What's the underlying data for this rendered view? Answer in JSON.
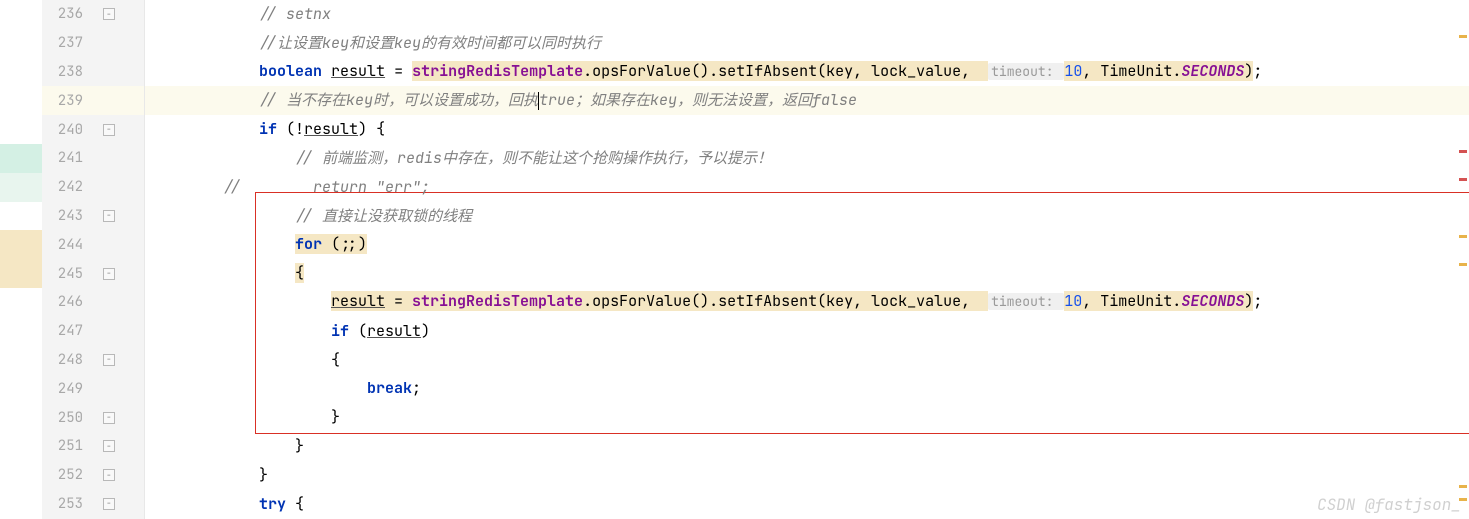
{
  "watermark": "CSDN @fastjson_",
  "lines": [
    {
      "num": "236",
      "fold": true,
      "segments": [
        {
          "indent": "            ",
          "cls": ""
        },
        {
          "text": "// setnx",
          "cls": "comment"
        }
      ]
    },
    {
      "num": "237",
      "fold": false,
      "segments": [
        {
          "indent": "            ",
          "cls": ""
        },
        {
          "text": "//让设置key和设置key的有效时间都可以同时执行",
          "cls": "comment"
        }
      ]
    },
    {
      "num": "238",
      "fold": false,
      "highlight": true,
      "segments": [
        {
          "indent": "            ",
          "cls": ""
        },
        {
          "text": "boolean",
          "cls": "keyword"
        },
        {
          "text": " ",
          "cls": ""
        },
        {
          "text": "result",
          "cls": "underline"
        },
        {
          "text": " = ",
          "cls": ""
        },
        {
          "text": "stringRedisTemplate",
          "cls": "field hl-yellow"
        },
        {
          "text": ".opsForValue().setIfAbsent(key, lock_value,  ",
          "cls": "hl-yellow"
        },
        {
          "text": "timeout: ",
          "cls": "param-hint"
        },
        {
          "text": "10",
          "cls": "number hl-yellow"
        },
        {
          "text": ", TimeUnit.",
          "cls": "hl-yellow"
        },
        {
          "text": "SECONDS",
          "cls": "field-italic hl-yellow"
        },
        {
          "text": ")",
          "cls": "hl-yellow"
        },
        {
          "text": ";",
          "cls": ""
        }
      ]
    },
    {
      "num": "239",
      "fold": false,
      "currentLine": true,
      "segments": [
        {
          "indent": "            ",
          "cls": ""
        },
        {
          "text": "// 当不存在key时，可以设置成功，回执",
          "cls": "comment"
        },
        {
          "caret": true
        },
        {
          "text": "true；如果存在key，则无法设置，返回false",
          "cls": "comment"
        }
      ]
    },
    {
      "num": "240",
      "fold": true,
      "segments": [
        {
          "indent": "            ",
          "cls": ""
        },
        {
          "text": "if",
          "cls": "keyword"
        },
        {
          "text": " (!",
          "cls": ""
        },
        {
          "text": "result",
          "cls": "underline"
        },
        {
          "text": ") {",
          "cls": ""
        }
      ]
    },
    {
      "num": "241",
      "fold": false,
      "leftBar": "#d4f0e4",
      "segments": [
        {
          "indent": "                ",
          "cls": ""
        },
        {
          "text": "// 前端监测，redis中存在，则不能让这个抢购操作执行，予以提示！",
          "cls": "comment"
        }
      ]
    },
    {
      "num": "242",
      "fold": false,
      "leftBar": "#e8f5ee",
      "segments": [
        {
          "indent": "        ",
          "cls": ""
        },
        {
          "text": "//        return \"err\";",
          "cls": "comment"
        }
      ]
    },
    {
      "num": "243",
      "fold": true,
      "segments": [
        {
          "indent": "                ",
          "cls": ""
        },
        {
          "text": "// 直接让没获取锁的线程",
          "cls": "comment"
        }
      ]
    },
    {
      "num": "244",
      "fold": false,
      "leftBar": "#f5e7c4",
      "segments": [
        {
          "indent": "                ",
          "cls": ""
        },
        {
          "text": "for",
          "cls": "keyword hl-yellow"
        },
        {
          "text": " (;;)",
          "cls": "hl-yellow"
        }
      ]
    },
    {
      "num": "245",
      "fold": true,
      "leftBar": "#f5e7c4",
      "segments": [
        {
          "indent": "                ",
          "cls": ""
        },
        {
          "text": "{",
          "cls": "hl-yellow"
        }
      ]
    },
    {
      "num": "246",
      "fold": false,
      "segments": [
        {
          "indent": "                    ",
          "cls": ""
        },
        {
          "text": "result",
          "cls": "underline hl-yellow"
        },
        {
          "text": " = ",
          "cls": "hl-yellow"
        },
        {
          "text": "stringRedisTemplate",
          "cls": "field hl-yellow"
        },
        {
          "text": ".opsForValue().setIfAbsent(key, lock_value,  ",
          "cls": "hl-yellow"
        },
        {
          "text": "timeout: ",
          "cls": "param-hint"
        },
        {
          "text": "10",
          "cls": "number hl-yellow"
        },
        {
          "text": ", TimeUnit.",
          "cls": "hl-yellow"
        },
        {
          "text": "SECONDS",
          "cls": "field-italic hl-yellow"
        },
        {
          "text": ")",
          "cls": "hl-yellow"
        },
        {
          "text": ";",
          "cls": ""
        }
      ]
    },
    {
      "num": "247",
      "fold": false,
      "segments": [
        {
          "indent": "                    ",
          "cls": ""
        },
        {
          "text": "if",
          "cls": "keyword"
        },
        {
          "text": " (",
          "cls": ""
        },
        {
          "text": "result",
          "cls": "underline"
        },
        {
          "text": ")",
          "cls": ""
        }
      ]
    },
    {
      "num": "248",
      "fold": true,
      "segments": [
        {
          "indent": "                    ",
          "cls": ""
        },
        {
          "text": "{",
          "cls": ""
        }
      ]
    },
    {
      "num": "249",
      "fold": false,
      "segments": [
        {
          "indent": "                        ",
          "cls": ""
        },
        {
          "text": "break",
          "cls": "keyword"
        },
        {
          "text": ";",
          "cls": ""
        }
      ]
    },
    {
      "num": "250",
      "fold": true,
      "segments": [
        {
          "indent": "                    ",
          "cls": ""
        },
        {
          "text": "}",
          "cls": ""
        }
      ]
    },
    {
      "num": "251",
      "fold": true,
      "segments": [
        {
          "indent": "                ",
          "cls": ""
        },
        {
          "text": "}",
          "cls": ""
        }
      ]
    },
    {
      "num": "252",
      "fold": true,
      "segments": [
        {
          "indent": "            ",
          "cls": ""
        },
        {
          "text": "}",
          "cls": ""
        }
      ]
    },
    {
      "num": "253",
      "fold": true,
      "segments": [
        {
          "indent": "            ",
          "cls": ""
        },
        {
          "text": "try",
          "cls": "keyword"
        },
        {
          "text": " {",
          "cls": ""
        }
      ]
    }
  ]
}
